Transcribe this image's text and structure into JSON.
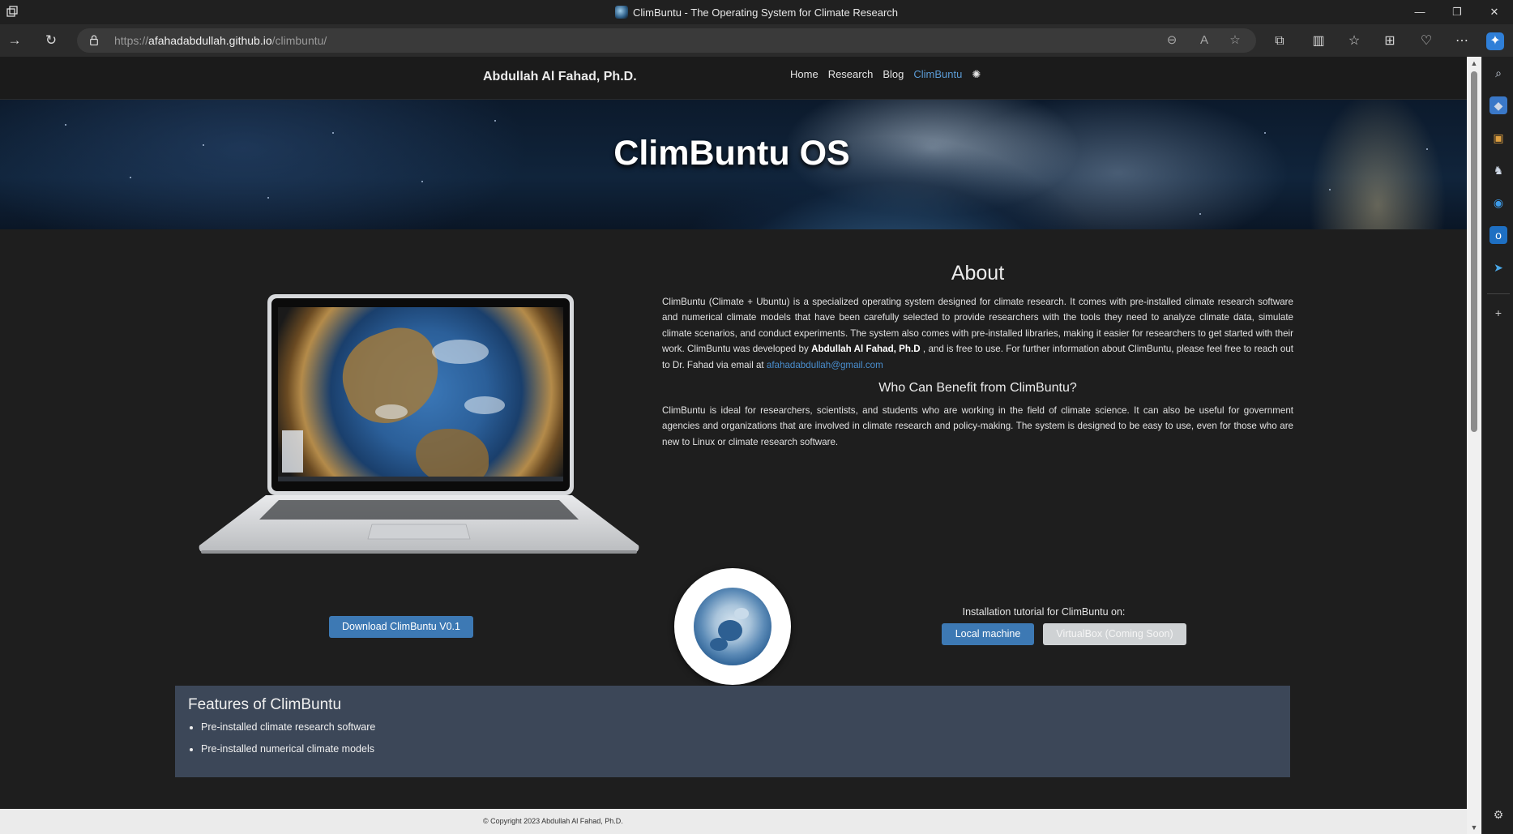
{
  "browser": {
    "window_title": "ClimBuntu - The Operating System for Climate Research",
    "url_prefix": "https://",
    "url_host": "afahadabdullah.github.io",
    "url_path": "/climbuntu/"
  },
  "site": {
    "brand": "Abdullah Al Fahad, Ph.D.",
    "menu": [
      {
        "label": "Home"
      },
      {
        "label": "Research"
      },
      {
        "label": "Blog"
      },
      {
        "label": "ClimBuntu"
      }
    ],
    "hero_title": "ClimBuntu OS"
  },
  "about": {
    "title": "About",
    "text_part1": "ClimBuntu (Climate + Ubuntu) is a specialized operating system designed for climate research. It comes with pre-installed climate research software and numerical climate models that have been carefully selected to provide researchers with the tools they need to analyze climate data, simulate climate scenarios, and conduct experiments. The system also comes with pre-installed libraries, making it easier for researchers to get started with their work. ClimBuntu was developed by ",
    "author": "Abdullah Al Fahad, Ph.D",
    "text_part2": " , and is free to use. For further information about ClimBuntu, please feel free to reach out to Dr. Fahad via email at ",
    "email": "afahadabdullah@gmail.com",
    "who_title": "Who Can Benefit from ClimBuntu?",
    "who_text": "ClimBuntu is ideal for researchers, scientists, and students who are working in the field of climate science. It can also be useful for government agencies and organizations that are involved in climate research and policy-making. The system is designed to be easy to use, even for those who are new to Linux or climate research software."
  },
  "download": {
    "button": "Download ClimBuntu V0.1",
    "install_label": "Installation tutorial for ClimBuntu on:",
    "local_button": "Local machine",
    "vbox_button": "VirtualBox (Coming Soon)"
  },
  "features": {
    "title": "Features of ClimBuntu",
    "items": [
      "Pre-installed climate research software",
      "Pre-installed numerical climate models"
    ]
  },
  "footer": {
    "copyright": "© Copyright 2023 Abdullah Al Fahad, Ph.D."
  }
}
